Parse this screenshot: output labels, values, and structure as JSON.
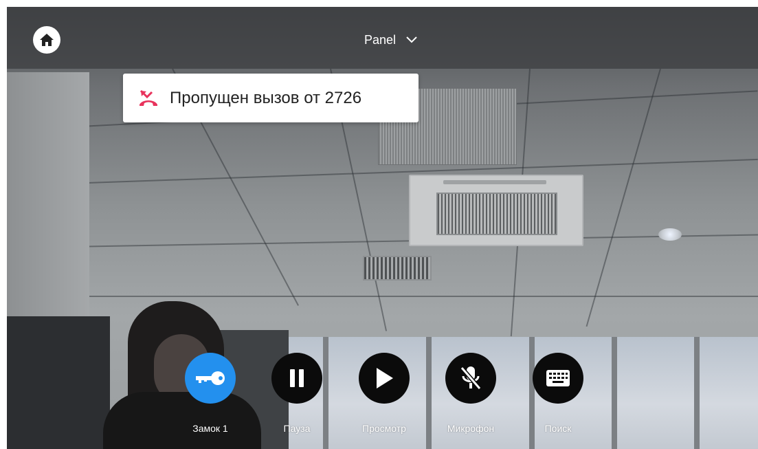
{
  "topbar": {
    "panel_label": "Panel",
    "home_icon": "home-icon",
    "dropdown_icon": "chevron-down-icon"
  },
  "toast": {
    "icon": "missed-call-icon",
    "message": "Пропущен вызов от  2726"
  },
  "controls": [
    {
      "label": "Замок 1",
      "icon": "key-icon",
      "active": true
    },
    {
      "label": "Пауза",
      "icon": "pause-icon",
      "active": false
    },
    {
      "label": "Просмотр",
      "icon": "play-icon",
      "active": false
    },
    {
      "label": "Микрофон",
      "icon": "mic-off-icon",
      "active": false
    },
    {
      "label": "Поиск",
      "icon": "keyboard-icon",
      "active": false
    }
  ],
  "colors": {
    "accent": "#2390ee",
    "button_dark": "#0b0b0b",
    "missed_call": "#e8335c"
  }
}
